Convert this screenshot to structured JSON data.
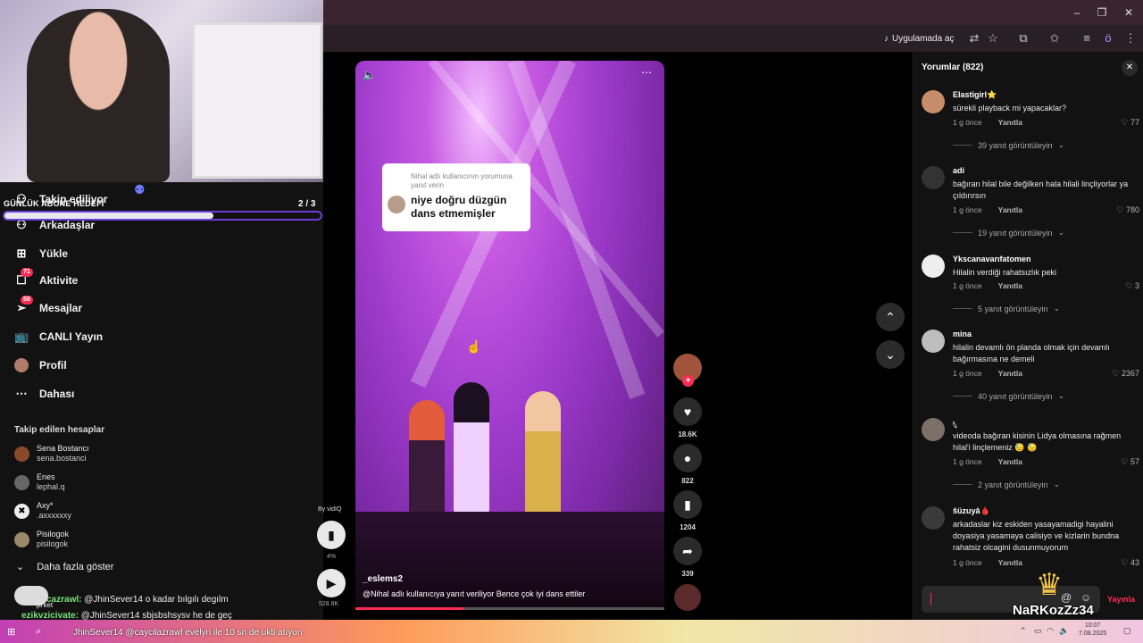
{
  "browser": {
    "open_in_app": "Uygulamada aç",
    "profile_initial": "ö"
  },
  "goal": {
    "label": "GÜNLÜK ABONE HEDEFİ",
    "count": "2 / 3",
    "progress": 0.66
  },
  "sidebar": {
    "items": [
      {
        "label": "Takip ediliyor",
        "icon": "users-icon"
      },
      {
        "label": "Arkadaşlar",
        "icon": "friends-icon"
      },
      {
        "label": "Yükle",
        "icon": "plus-square-icon"
      },
      {
        "label": "Aktivite",
        "icon": "inbox-icon",
        "badge": "71"
      },
      {
        "label": "Mesajlar",
        "icon": "send-icon",
        "badge": "58"
      },
      {
        "label": "CANLI Yayın",
        "icon": "live-tv-icon"
      },
      {
        "label": "Profil",
        "icon": "avatar-icon"
      },
      {
        "label": "Dahası",
        "icon": "more-icon"
      }
    ],
    "following_title": "Takip edilen hesaplar",
    "following": [
      {
        "name": "Sena Bostancı",
        "handle": "sena.bostanci"
      },
      {
        "name": "Enes",
        "handle": "lephal.q"
      },
      {
        "name": "Axy*",
        "handle": ".axxxxxxy"
      },
      {
        "name": "Pisilogok",
        "handle": "pisilogok"
      }
    ],
    "show_more": "Daha fazla göster"
  },
  "chat": [
    {
      "name": "cazrawl:",
      "text": "@JhinSever14 o kadar bılgılı degılm"
    },
    {
      "name": "ezikvzicivate:",
      "text": "@JhinSever14 sbjsbshsysv he de geç"
    }
  ],
  "chat_partial": "şirket",
  "ticker": "JhinSever14 @caycilazrawl evelyn ile 10 sn de ukti atıyon",
  "video": {
    "reply_small": "Nihal adlı kullanıcının yorumuna yanıt verin",
    "reply_big": "niye doğru düzgün dans etmemişler",
    "author": "_eslems2",
    "description": "@Nihal  adlı kullanıcıya yanıt veriliyor  Bence çok iyi dans ettiler",
    "progress": 0.35
  },
  "actions": {
    "likes": "18.6K",
    "comments": "822",
    "saves": "1204",
    "shares": "339"
  },
  "vidiq": {
    "by": "By vidIQ",
    "percent": "4%",
    "views": "528.8K"
  },
  "comments": {
    "title": "Yorumlar (822)",
    "items": [
      {
        "user": "Elastigirl⭐",
        "text": "sürekli playback mi yapacaklar?",
        "time": "1 g önce",
        "reply": "Yanıtla",
        "likes": "77",
        "views": "39 yanıt görüntüleyin"
      },
      {
        "user": "adi",
        "text": "bağıran hilal bile değilken hala hilali linçliyorlar ya çıldırırsın",
        "time": "1 g önce",
        "reply": "Yanıtla",
        "likes": "780",
        "views": "19 yanıt görüntüleyin"
      },
      {
        "user": "Ykscanavarıfatomen",
        "text": "Hilalin verdiği rahatsızlık peki",
        "time": "1 g önce",
        "reply": "Yanıtla",
        "likes": "3",
        "views": "5 yanıt görüntüleyin"
      },
      {
        "user": "mina",
        "text": "hilalin devamlı ön planda olmak için devamlı bağırmasına ne demeli",
        "time": "1 g önce",
        "reply": "Yanıtla",
        "likes": "2367",
        "views": "40 yanıt görüntüleyin"
      },
      {
        "user": "𓆩",
        "text": "videoda bağıran kisinin Lidya olmasına rağmen hilal'i linçlemeniz 😓 😓",
        "time": "1 g önce",
        "reply": "Yanıtla",
        "likes": "57",
        "views": "2 yanıt görüntüleyin"
      },
      {
        "user": "ŝüzuyâ🩸",
        "text": "arkadaslar kiz eskiden yasayamadigi hayalini doyasiya yasamaya calisiyo ve kizlarin bundna rahatsiz olcagini dusunmuyorum",
        "time": "1 g önce",
        "reply": "Yanıtla",
        "likes": "43",
        "views": ""
      }
    ],
    "post": "Yayınla"
  },
  "streamer": "NaRKozZz34",
  "clock": {
    "time": "10:07",
    "date": "7.08.2025"
  }
}
